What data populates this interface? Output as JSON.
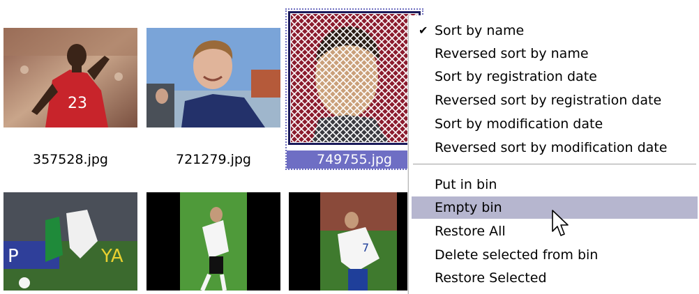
{
  "thumbnails": [
    {
      "name": "357528.jpg"
    },
    {
      "name": "721279.jpg"
    },
    {
      "name": "749755.jpg",
      "selected": true
    }
  ],
  "context_menu": {
    "items": [
      {
        "label": "Sort by name",
        "checked": true
      },
      {
        "label": "Reversed sort by name"
      },
      {
        "label": "Sort by registration date"
      },
      {
        "label": "Reversed sort by registration date"
      },
      {
        "label": "Sort by modification date"
      },
      {
        "label": "Reversed sort by modification date"
      },
      {
        "label": "Put in bin"
      },
      {
        "label": "Empty bin",
        "hovered": true
      },
      {
        "label": "Restore All"
      },
      {
        "label": "Delete selected from bin"
      },
      {
        "label": "Restore Selected"
      }
    ],
    "check_glyph": "✔"
  },
  "colors": {
    "selection": "#6e6ec4",
    "menu_hover": "#b6b6cf"
  }
}
